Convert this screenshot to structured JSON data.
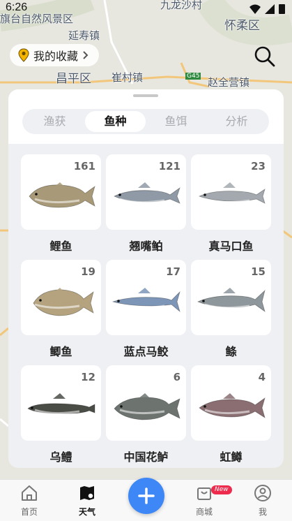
{
  "status_bar": {
    "time": "6:26"
  },
  "map": {
    "labels": [
      {
        "text": "旗台自然风景区",
        "size": "normal"
      },
      {
        "text": "九龙沙村",
        "size": "normal"
      },
      {
        "text": "延寿镇",
        "size": "normal"
      },
      {
        "text": "怀柔区",
        "size": "big"
      },
      {
        "text": "昌平区",
        "size": "big"
      },
      {
        "text": "崔村镇",
        "size": "normal"
      },
      {
        "text": "赵全营镇",
        "size": "normal"
      },
      {
        "text": "G45",
        "size": "road"
      }
    ]
  },
  "header": {
    "favorites_label": "我的收藏"
  },
  "sheet": {
    "tabs": [
      {
        "label": "渔获",
        "active": false
      },
      {
        "label": "鱼种",
        "active": true
      },
      {
        "label": "鱼饵",
        "active": false
      },
      {
        "label": "分析",
        "active": false
      }
    ],
    "fish": [
      {
        "name": "鲤鱼",
        "count": "161",
        "shape": "carp",
        "color": "#a89a78"
      },
      {
        "name": "翘嘴鲌",
        "count": "121",
        "shape": "slim",
        "color": "#8f9aa6"
      },
      {
        "name": "真马口鱼",
        "count": "23",
        "shape": "slim2",
        "color": "#a3a9ae"
      },
      {
        "name": "鲫鱼",
        "count": "19",
        "shape": "crucian",
        "color": "#b4a37e"
      },
      {
        "name": "蓝点马鲛",
        "count": "17",
        "shape": "mackerel",
        "color": "#7d96b8"
      },
      {
        "name": "鲦",
        "count": "15",
        "shape": "slim3",
        "color": "#8e979c"
      },
      {
        "name": "乌鳢",
        "count": "12",
        "shape": "snakehead",
        "color": "#4a4d46"
      },
      {
        "name": "中国花鲈",
        "count": "6",
        "shape": "bass",
        "color": "#6d7470"
      },
      {
        "name": "虹鳟",
        "count": "4",
        "shape": "trout",
        "color": "#8a6e72"
      }
    ]
  },
  "nav": {
    "items": [
      {
        "label": "首页",
        "icon": "home-icon",
        "active": false
      },
      {
        "label": "天气",
        "icon": "weather-map-icon",
        "active": true
      },
      {
        "label": "商城",
        "icon": "shop-icon",
        "active": false,
        "badge": "New"
      },
      {
        "label": "我",
        "icon": "profile-icon",
        "active": false
      }
    ],
    "accent": "#3e87f6"
  }
}
